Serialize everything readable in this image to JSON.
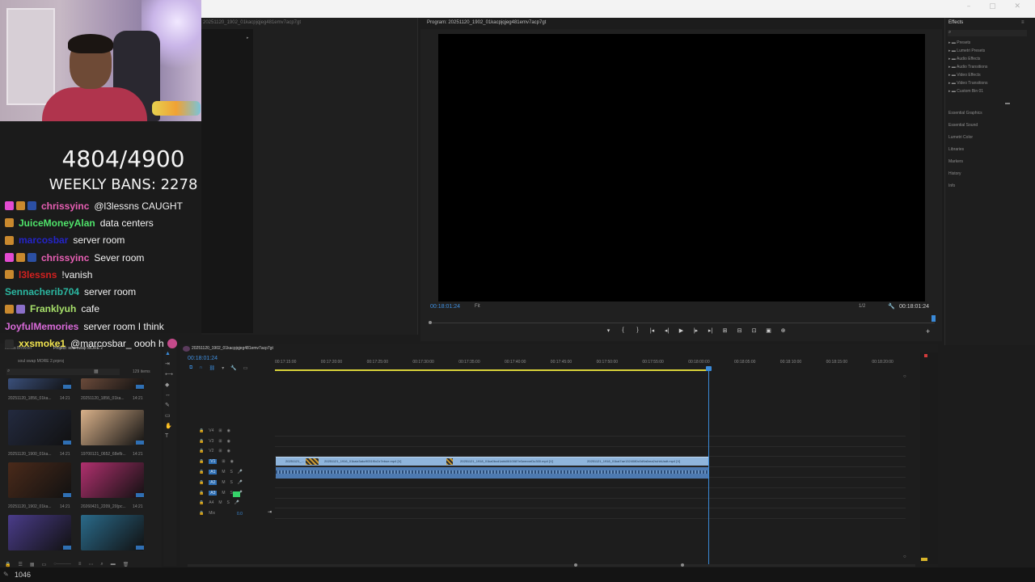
{
  "window": {
    "controls": "– ▢ ✕"
  },
  "overlay": {
    "counter": "4804/4900",
    "weekly_bans": "WEEKLY BANS: 2278"
  },
  "chat": [
    {
      "user": "chrissyinc",
      "message": "@l3lessns CAUGHT",
      "color": "#e85fb4",
      "badges": [
        "#e34bd1",
        "#c9892e",
        "#2b4fa3"
      ]
    },
    {
      "user": "JuiceMoneyAlan",
      "message": "data centers",
      "color": "#4fe36a",
      "badges": [
        "#c9892e"
      ]
    },
    {
      "user": "marcosbar",
      "message": "server room",
      "color": "#2424c9",
      "badges": [
        "#c9892e"
      ]
    },
    {
      "user": "chrissyinc",
      "message": "Sever room",
      "color": "#e85fb4",
      "badges": [
        "#e34bd1",
        "#c9892e",
        "#2b4fa3"
      ]
    },
    {
      "user": "l3lessns",
      "message": "!vanish",
      "color": "#d4201f",
      "badges": [
        "#c9892e"
      ]
    },
    {
      "user": "Sennacherib704",
      "message": "server room",
      "color": "#2bb8a2",
      "badges": []
    },
    {
      "user": "Franklyuh",
      "message": "cafe",
      "color": "#a7e06a",
      "badges": [
        "#c9892e",
        "#8b6fc9"
      ]
    },
    {
      "user": "JoyfulMemories",
      "message": "server room I think",
      "color": "#d86ad8",
      "badges": []
    },
    {
      "user": "xxsmoke1",
      "message": "@marcosbar_ oooh h",
      "color": "#f0e34f",
      "badges": [
        "#2b2b2b"
      ]
    }
  ],
  "source": {
    "tab": "20251120_1902_01kacpjqjeg481emv7acp7gt"
  },
  "program": {
    "title": "Program: 20251120_1902_01kacpjqjeg481emv7acp7gt",
    "timecode_left": "00:18:01:24",
    "fit": "Fit",
    "resolution": "1/2",
    "timecode_right": "00:18:01:24",
    "transport": [
      "▾",
      "{",
      "}",
      "|◂",
      "◂|",
      "▶",
      "|▸",
      "▸|",
      "⊞",
      "⊟",
      "⊡",
      "▣",
      "⊕"
    ]
  },
  "effects": {
    "title": "Effects",
    "tree": [
      "Presets",
      "Lumetri Presets",
      "Audio Effects",
      "Audio Transitions",
      "Video Effects",
      "Video Transitions",
      "Custom Bin 01"
    ],
    "panels": [
      "Essential Graphics",
      "Essential Sound",
      "Lumetri Color",
      "Libraries",
      "Markers",
      "History",
      "Info"
    ]
  },
  "project": {
    "tab_media": "Media Browser",
    "tab_project": "Project: soul swap MORE 2",
    "file": "soul swap MORE 2.prproj",
    "count": "129 items",
    "thumbs": [
      {
        "label": "20251120_1856_01ka...",
        "dur": "14:21",
        "color": "#3a4f7a"
      },
      {
        "label": "20251120_1856_01ka...",
        "dur": "14:21",
        "color": "#6a4a3a"
      },
      {
        "label": "20251120_1900_01ka...",
        "dur": "14:21",
        "color": "#232a3f"
      },
      {
        "label": "19700121_0652_68efb...",
        "dur": "14:21",
        "color": "#d9b18a"
      },
      {
        "label": "20251120_1902_01ka...",
        "dur": "14:21",
        "color": "#4a2a1a"
      },
      {
        "label": "20260421_2209_20(pc...",
        "dur": "14:21",
        "color": "#b0306e"
      },
      {
        "label": "",
        "dur": "",
        "color": "#4a3c8a"
      },
      {
        "label": "",
        "dur": "",
        "color": "#2a6a8a"
      }
    ]
  },
  "timeline": {
    "tab": "20251120_1902_01kacpjqjeg481emv7acp7gt",
    "timecode": "00:18:01:24",
    "ruler": [
      "00:17:15:00",
      "00:17:20:00",
      "00:17:25:00",
      "00:17:30:00",
      "00:17:35:00",
      "00:17:40:00",
      "00:17:45:00",
      "00:17:50:00",
      "00:17:55:00",
      "00:18:00:00",
      "00:18:05:00",
      "00:18:10:00",
      "00:18:15:00",
      "00:18:20:00"
    ],
    "tracks": [
      "V4",
      "V3",
      "V2",
      "V1",
      "A1",
      "A2",
      "A3",
      "A4",
      "Mix"
    ],
    "clips": [
      "20251121_...",
      "20251121_1916_01kaiz3akc9031f0x2z7ebue.mp4 [V]",
      "20251121_1918_01ka0bcd1abk0610087e0wexxeDu300.mp4 [V]",
      "20251121_1918_01kai7ae1324080c0d9a6rea2ruhbUadt.mp4 [V]"
    ],
    "mix_value": "0.0"
  },
  "status": {
    "count": "1046"
  }
}
